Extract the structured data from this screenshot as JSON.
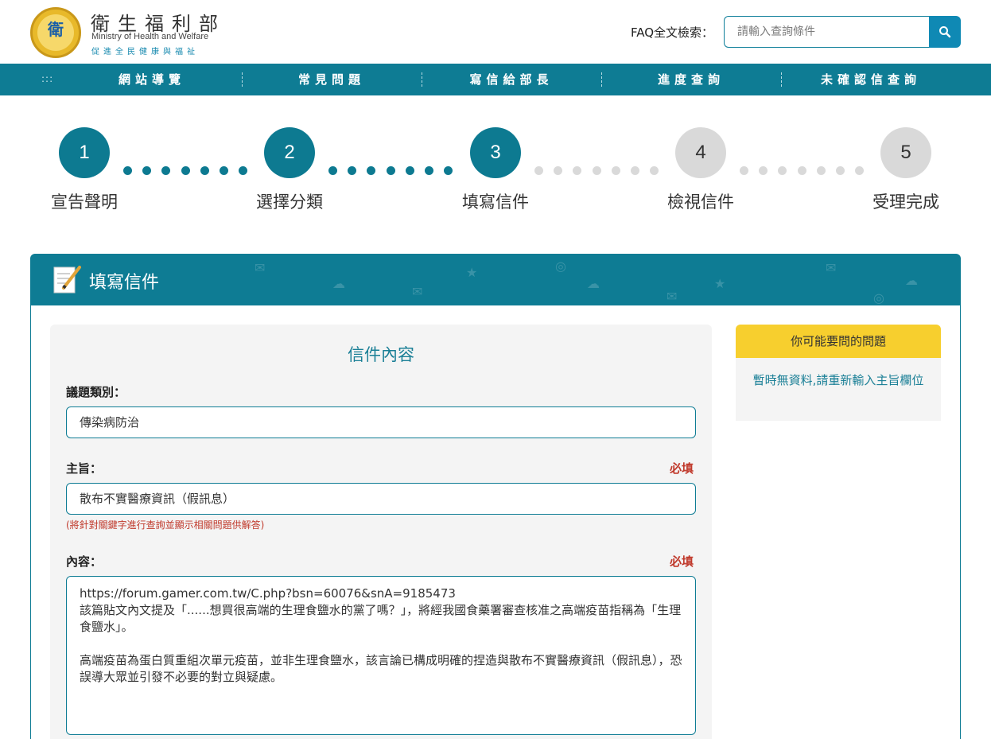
{
  "header": {
    "logo_zh": "衛生福利部",
    "logo_en": "Ministry of Health and Welfare",
    "logo_slogan": "促進全民健康與福祉",
    "faq_label": "FAQ全文檢索：",
    "faq_placeholder": "請輸入查詢條件"
  },
  "nav": {
    "dots": ":::",
    "items": [
      "網站導覽",
      "常見問題",
      "寫信給部長",
      "進度查詢",
      "未確認信查詢"
    ]
  },
  "steps": [
    {
      "num": "1",
      "label": "宣告聲明",
      "state": "active"
    },
    {
      "num": "2",
      "label": "選擇分類",
      "state": "active"
    },
    {
      "num": "3",
      "label": "填寫信件",
      "state": "active"
    },
    {
      "num": "4",
      "label": "檢視信件",
      "state": "inactive"
    },
    {
      "num": "5",
      "label": "受理完成",
      "state": "inactive"
    }
  ],
  "panel": {
    "title": "填寫信件"
  },
  "form": {
    "title": "信件內容",
    "category_label": "議題類別：",
    "category_value": "傳染病防治",
    "subject_label": "主旨：",
    "subject_required": "必填",
    "subject_value": "散布不實醫療資訊（假訊息）",
    "subject_hint": "(將針對關鍵字進行查詢並顯示相關問題供解答)",
    "content_label": "內容：",
    "content_required": "必填",
    "content_value": "https://forum.gamer.com.tw/C.php?bsn=60076&snA=9185473\n該篇貼文內文提及「......想買很高端的生理食鹽水的黨了嗎？」，將經我國食藥署審查核准之高端疫苗指稱為「生理食鹽水」。\n\n高端疫苗為蛋白質重組次單元疫苗，並非生理食鹽水，該言論已構成明確的捏造與散布不實醫療資訊（假訊息），恐誤導大眾並引發不必要的對立與疑慮。"
  },
  "sidebar": {
    "title": "你可能要問的問題",
    "message": "暫時無資料,請重新輸入主旨欄位"
  },
  "colors": {
    "primary": "#0e7c94",
    "accent_yellow": "#f7cf2e",
    "required_red": "#c0392b"
  }
}
